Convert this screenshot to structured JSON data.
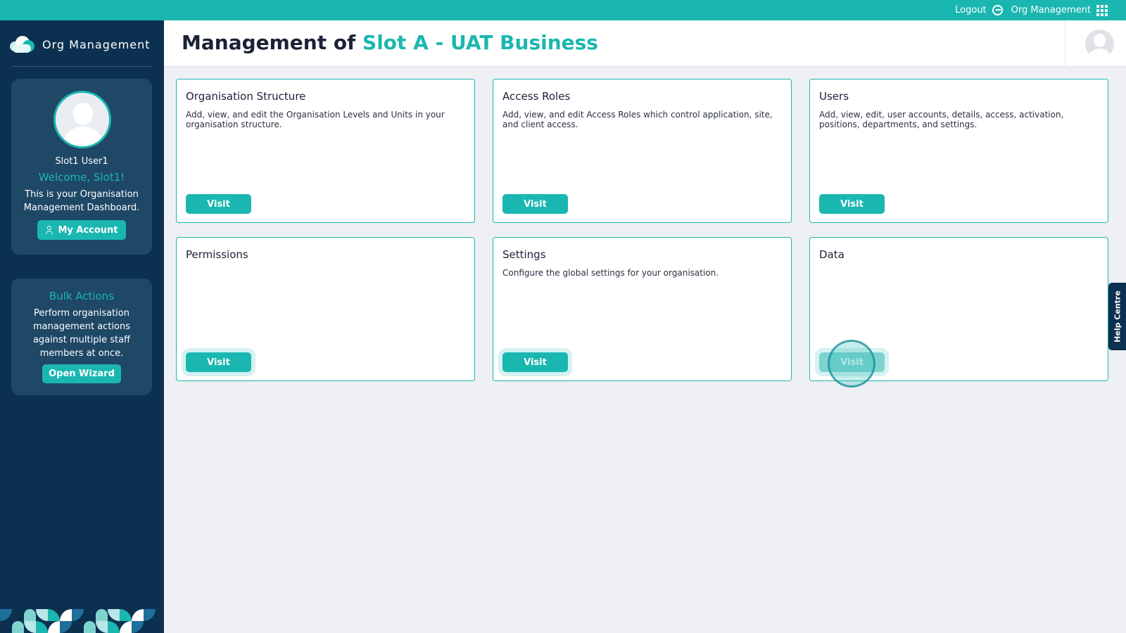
{
  "topbar": {
    "logout_label": "Logout",
    "app_label": "Org Management"
  },
  "sidebar": {
    "brand_title": "Org Management",
    "profile": {
      "user_name": "Slot1 User1",
      "welcome": "Welcome, Slot1!",
      "dashboard_text": "This is your Organisation Management Dashboard.",
      "my_account_label": "My Account"
    },
    "bulk": {
      "title": "Bulk Actions",
      "text": "Perform organisation management actions against multiple staff members at once.",
      "button_label": "Open Wizard"
    }
  },
  "header": {
    "title_prefix": "Management of",
    "title_accent": "Slot A - UAT Business"
  },
  "cards": [
    {
      "title": "Organisation Structure",
      "description": "Add, view, and edit the Organisation Levels and Units in your organisation structure.",
      "button_label": "Visit"
    },
    {
      "title": "Access Roles",
      "description": "Add, view, and edit Access Roles which control application, site, and client access.",
      "button_label": "Visit"
    },
    {
      "title": "Users",
      "description": "Add, view, edit, user accounts, details, access, activation, positions, departments, and settings.",
      "button_label": "Visit"
    },
    {
      "title": "Permissions",
      "description": "",
      "button_label": "Visit"
    },
    {
      "title": "Settings",
      "description": "Configure the global settings for your organisation.",
      "button_label": "Visit"
    },
    {
      "title": "Data",
      "description": "",
      "button_label": "Visit"
    }
  ],
  "help_tab": {
    "label": "Help Centre"
  },
  "colors": {
    "accent": "#1ab7b0",
    "sidebar_bg": "#0c3150",
    "sidebar_card": "#1f4766",
    "page_bg": "#eff0f4"
  }
}
